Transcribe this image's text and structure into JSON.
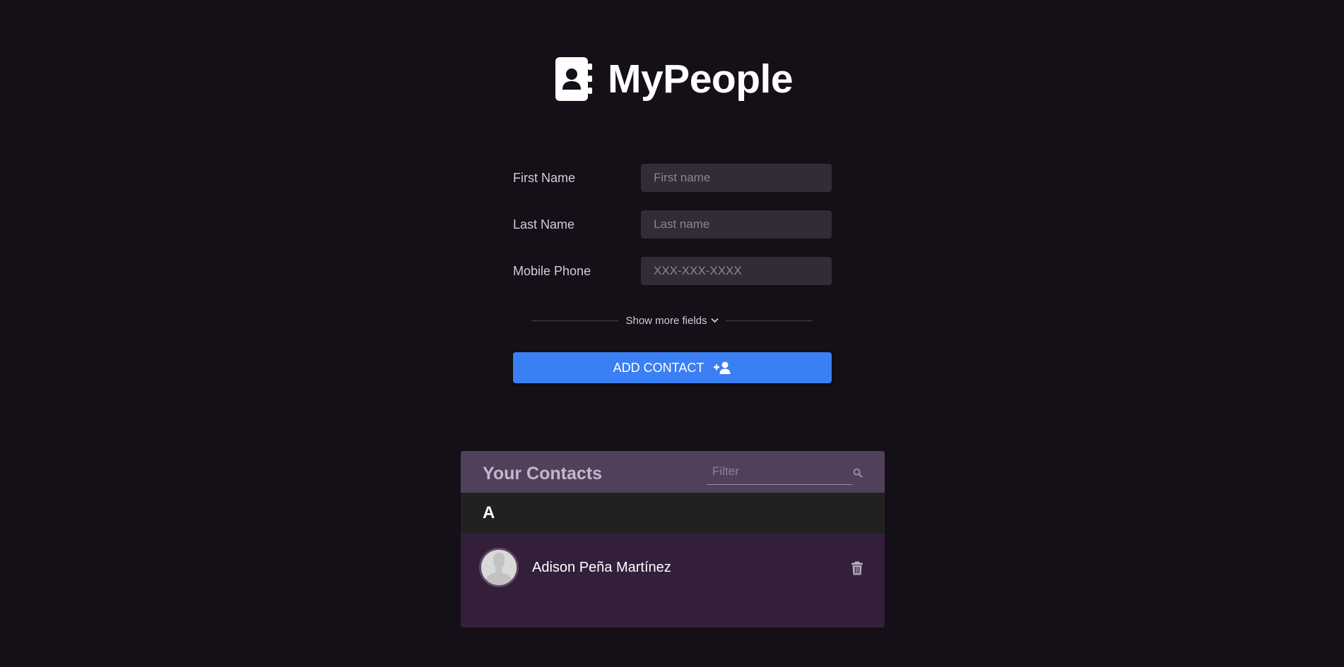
{
  "header": {
    "app_name": "MyPeople",
    "logo_icon": "address-book-icon"
  },
  "form": {
    "first_name": {
      "label": "First Name",
      "placeholder": "First name",
      "value": ""
    },
    "last_name": {
      "label": "Last Name",
      "placeholder": "Last name",
      "value": ""
    },
    "mobile_phone": {
      "label": "Mobile Phone",
      "placeholder": "XXX-XXX-XXXX",
      "value": ""
    },
    "show_more_label": "Show more fields",
    "show_more_icon": "chevron-down-icon",
    "submit_label": "ADD CONTACT",
    "submit_icon": "user-plus-icon"
  },
  "contacts": {
    "title": "Your Contacts",
    "filter": {
      "placeholder": "Filter",
      "value": "",
      "icon": "search-icon"
    },
    "groups": [
      {
        "letter": "A",
        "items": [
          {
            "name": "Adison Peña Martínez",
            "avatar_icon": "default-avatar-icon",
            "delete_icon": "trash-icon"
          }
        ]
      }
    ]
  },
  "colors": {
    "background": "#150f17",
    "input_background": "#332c37",
    "primary": "#3a7ff3",
    "contacts_header": "#51405a",
    "contacts_body": "#341f3a",
    "letter_bar": "#212121"
  }
}
